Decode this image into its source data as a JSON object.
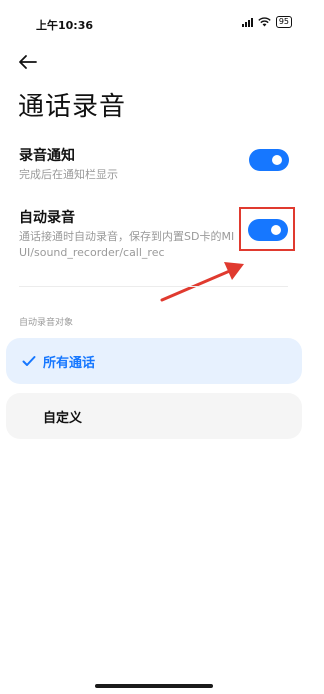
{
  "status_bar": {
    "time": "上午10:36",
    "battery": "95"
  },
  "header": {
    "title": "通话录音"
  },
  "settings": [
    {
      "title": "录音通知",
      "description": "完成后在通知栏显示",
      "enabled": true
    },
    {
      "title": "自动录音",
      "description": "通话接通时自动录音，保存到内置SD卡的MIUI/sound_recorder/call_rec",
      "enabled": true
    }
  ],
  "auto_record_section": {
    "label": "自动录音对象",
    "options": [
      {
        "label": "所有通话",
        "selected": true
      },
      {
        "label": "自定义",
        "selected": false
      }
    ]
  },
  "colors": {
    "accent": "#1677ff",
    "annotation": "#e03a2f"
  },
  "icons": [
    "back-arrow-icon",
    "signal-icon",
    "wifi-icon",
    "battery-icon",
    "check-icon"
  ]
}
